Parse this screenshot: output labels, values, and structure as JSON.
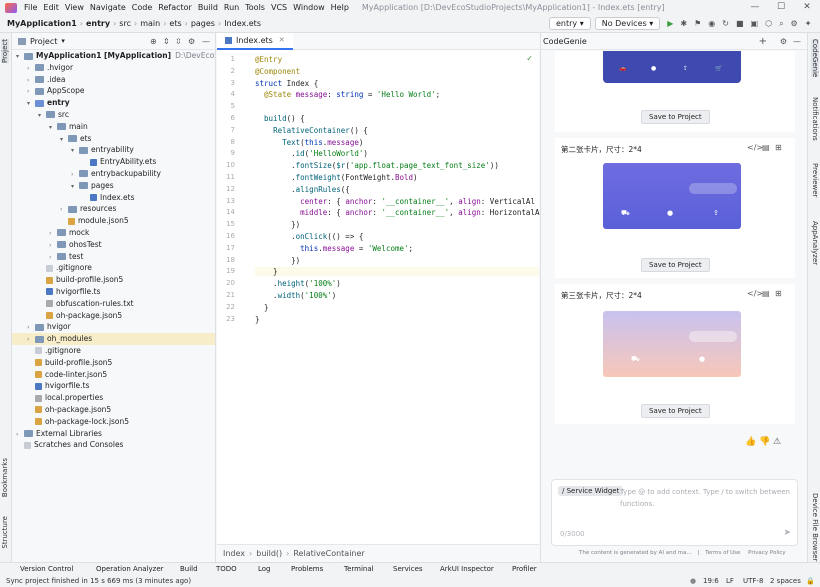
{
  "menu": {
    "items": [
      "File",
      "Edit",
      "View",
      "Navigate",
      "Code",
      "Refactor",
      "Build",
      "Run",
      "Tools",
      "VCS",
      "Window",
      "Help"
    ],
    "project_title": "MyApplication [D:\\DevEcoStudioProjects\\MyApplication1] - Index.ets [entry]"
  },
  "nav": {
    "crumbs": [
      "MyApplication1",
      "entry",
      "src",
      "main",
      "ets",
      "pages",
      "Index.ets"
    ],
    "run_config": "entry",
    "device": "No Devices"
  },
  "left_tabs": {
    "project": "Project",
    "bookmarks": "Bookmarks",
    "structure": "Structure"
  },
  "right_tabs": {
    "codegenie": "CodeGenie",
    "notifications": "Notifications",
    "previewer": "Previewer",
    "appanalyzer": "AppAnalyzer",
    "device_file": "Device File Browser"
  },
  "project_panel": {
    "title": "Project",
    "tree": [
      {
        "level": 0,
        "arrow": "▾",
        "type": "fold",
        "name": "MyApplication1 [MyApplication]",
        "extra": "D:\\DevEcoStudioP",
        "bold": true
      },
      {
        "level": 1,
        "arrow": "›",
        "type": "fold",
        "name": ".hvigor"
      },
      {
        "level": 1,
        "arrow": "›",
        "type": "fold",
        "name": ".idea"
      },
      {
        "level": 1,
        "arrow": "›",
        "type": "fold",
        "name": "AppScope"
      },
      {
        "level": 1,
        "arrow": "▾",
        "type": "fold src",
        "name": "entry",
        "bold": true
      },
      {
        "level": 2,
        "arrow": "▾",
        "type": "fold",
        "name": "src"
      },
      {
        "level": 3,
        "arrow": "▾",
        "type": "fold",
        "name": "main"
      },
      {
        "level": 4,
        "arrow": "▾",
        "type": "fold",
        "name": "ets"
      },
      {
        "level": 5,
        "arrow": "▾",
        "type": "fold",
        "name": "entryability"
      },
      {
        "level": 6,
        "arrow": "",
        "type": "file ets",
        "name": "EntryAbility.ets"
      },
      {
        "level": 5,
        "arrow": "›",
        "type": "fold",
        "name": "entrybackupability"
      },
      {
        "level": 5,
        "arrow": "▾",
        "type": "fold",
        "name": "pages"
      },
      {
        "level": 6,
        "arrow": "",
        "type": "file ets",
        "name": "Index.ets"
      },
      {
        "level": 4,
        "arrow": "›",
        "type": "fold",
        "name": "resources"
      },
      {
        "level": 4,
        "arrow": "",
        "type": "file json",
        "name": "module.json5"
      },
      {
        "level": 3,
        "arrow": "›",
        "type": "fold",
        "name": "mock"
      },
      {
        "level": 3,
        "arrow": "›",
        "type": "fold",
        "name": "ohosTest"
      },
      {
        "level": 3,
        "arrow": "›",
        "type": "fold",
        "name": "test"
      },
      {
        "level": 2,
        "arrow": "",
        "type": "file",
        "name": ".gitignore"
      },
      {
        "level": 2,
        "arrow": "",
        "type": "file json",
        "name": "build-profile.json5"
      },
      {
        "level": 2,
        "arrow": "",
        "type": "file ts",
        "name": "hvigorfile.ts"
      },
      {
        "level": 2,
        "arrow": "",
        "type": "file txt",
        "name": "obfuscation-rules.txt"
      },
      {
        "level": 2,
        "arrow": "",
        "type": "file json",
        "name": "oh-package.json5"
      },
      {
        "level": 1,
        "arrow": "›",
        "type": "fold",
        "name": "hvigor"
      },
      {
        "level": 1,
        "arrow": "›",
        "type": "fold",
        "name": "oh_modules",
        "hl": true
      },
      {
        "level": 1,
        "arrow": "",
        "type": "file",
        "name": ".gitignore"
      },
      {
        "level": 1,
        "arrow": "",
        "type": "file json",
        "name": "build-profile.json5"
      },
      {
        "level": 1,
        "arrow": "",
        "type": "file json",
        "name": "code-linter.json5"
      },
      {
        "level": 1,
        "arrow": "",
        "type": "file ts",
        "name": "hvigorfile.ts"
      },
      {
        "level": 1,
        "arrow": "",
        "type": "file txt",
        "name": "local.properties"
      },
      {
        "level": 1,
        "arrow": "",
        "type": "file json",
        "name": "oh-package.json5"
      },
      {
        "level": 1,
        "arrow": "",
        "type": "file json",
        "name": "oh-package-lock.json5"
      },
      {
        "level": 0,
        "arrow": "›",
        "type": "fold",
        "name": "External Libraries"
      },
      {
        "level": 0,
        "arrow": "",
        "type": "file",
        "name": "Scratches and Consoles"
      }
    ]
  },
  "editor": {
    "tab": "Index.ets",
    "lines": [
      "<span class=\"an\">@Entry</span>",
      "<span class=\"an\">@Component</span>",
      "<span class=\"kw\">struct</span> Index {",
      "  <span class=\"an\">@State</span> <span class=\"pl\">message</span>: <span class=\"kw\">string</span> = <span class=\"str\">'Hello World'</span>;",
      "",
      "  <span class=\"fn\">build</span>() {",
      "    <span class=\"fn\">RelativeContainer</span>() {",
      "      <span class=\"fn\">Text</span>(<span class=\"kw\">this</span>.<span class=\"pl\">message</span>)",
      "        .<span class=\"fn\">id</span>(<span class=\"str\">'HelloWorld'</span>)",
      "        .<span class=\"fn\">fontSize</span>(<span class=\"fn\">$r</span>(<span class=\"str\">'app.float.page_text_font_size'</span>))",
      "        .<span class=\"fn\">fontWeight</span>(FontWeight.<span class=\"pl\">Bold</span>)",
      "        .<span class=\"fn\">alignRules</span>({",
      "          <span class=\"pl\">center</span>: { <span class=\"pl\">anchor</span>: <span class=\"str\">'__container__'</span>, <span class=\"pl\">align</span>: VerticalAl",
      "          <span class=\"pl\">middle</span>: { <span class=\"pl\">anchor</span>: <span class=\"str\">'__container__'</span>, <span class=\"pl\">align</span>: HorizontalA",
      "        })",
      "        .<span class=\"fn\">onClick</span>(() => {",
      "          <span class=\"kw\">this</span>.<span class=\"pl\">message</span> = <span class=\"str\">'Welcome'</span>;",
      "        })",
      "    }",
      "    .<span class=\"fn\">height</span>(<span class=\"str\">'100%'</span>)",
      "    .<span class=\"fn\">width</span>(<span class=\"str\">'100%'</span>)",
      "  }",
      "}"
    ],
    "footer": [
      "Index",
      "build()",
      "RelativeContainer"
    ]
  },
  "genie": {
    "title": "CodeGenie",
    "save_label": "Save to Project",
    "card2_title": "第二张卡片，尺寸：2*4",
    "card3_title": "第三张卡片，尺寸：2*4",
    "input_tag": "/ Service Widget",
    "input_placeholder": "Type @ to add context. Type / to switch between functions.",
    "counter": "0/3000",
    "disclaimer": "The content is generated by AI and ma...",
    "terms": "Terms of Use",
    "privacy": "Privacy Policy",
    "colors": {
      "card1": "#3e4ab0",
      "card2_top": "#6f6ce0",
      "card2_bottom": "#5a60d8",
      "card3_top": "#c8c2f0",
      "card3_bottom": "#f7c7b8"
    }
  },
  "bottom_tabs": [
    "Version Control",
    "Operation Analyzer",
    "Build",
    "TODO",
    "Log",
    "Problems",
    "Terminal",
    "Services",
    "ArkUI Inspector",
    "Profiler"
  ],
  "status": {
    "message": "Sync project finished in 15 s 669 ms (3 minutes ago)",
    "position": "19:6",
    "line_sep": "LF",
    "encoding": "UTF-8",
    "indent": "2 spaces"
  }
}
